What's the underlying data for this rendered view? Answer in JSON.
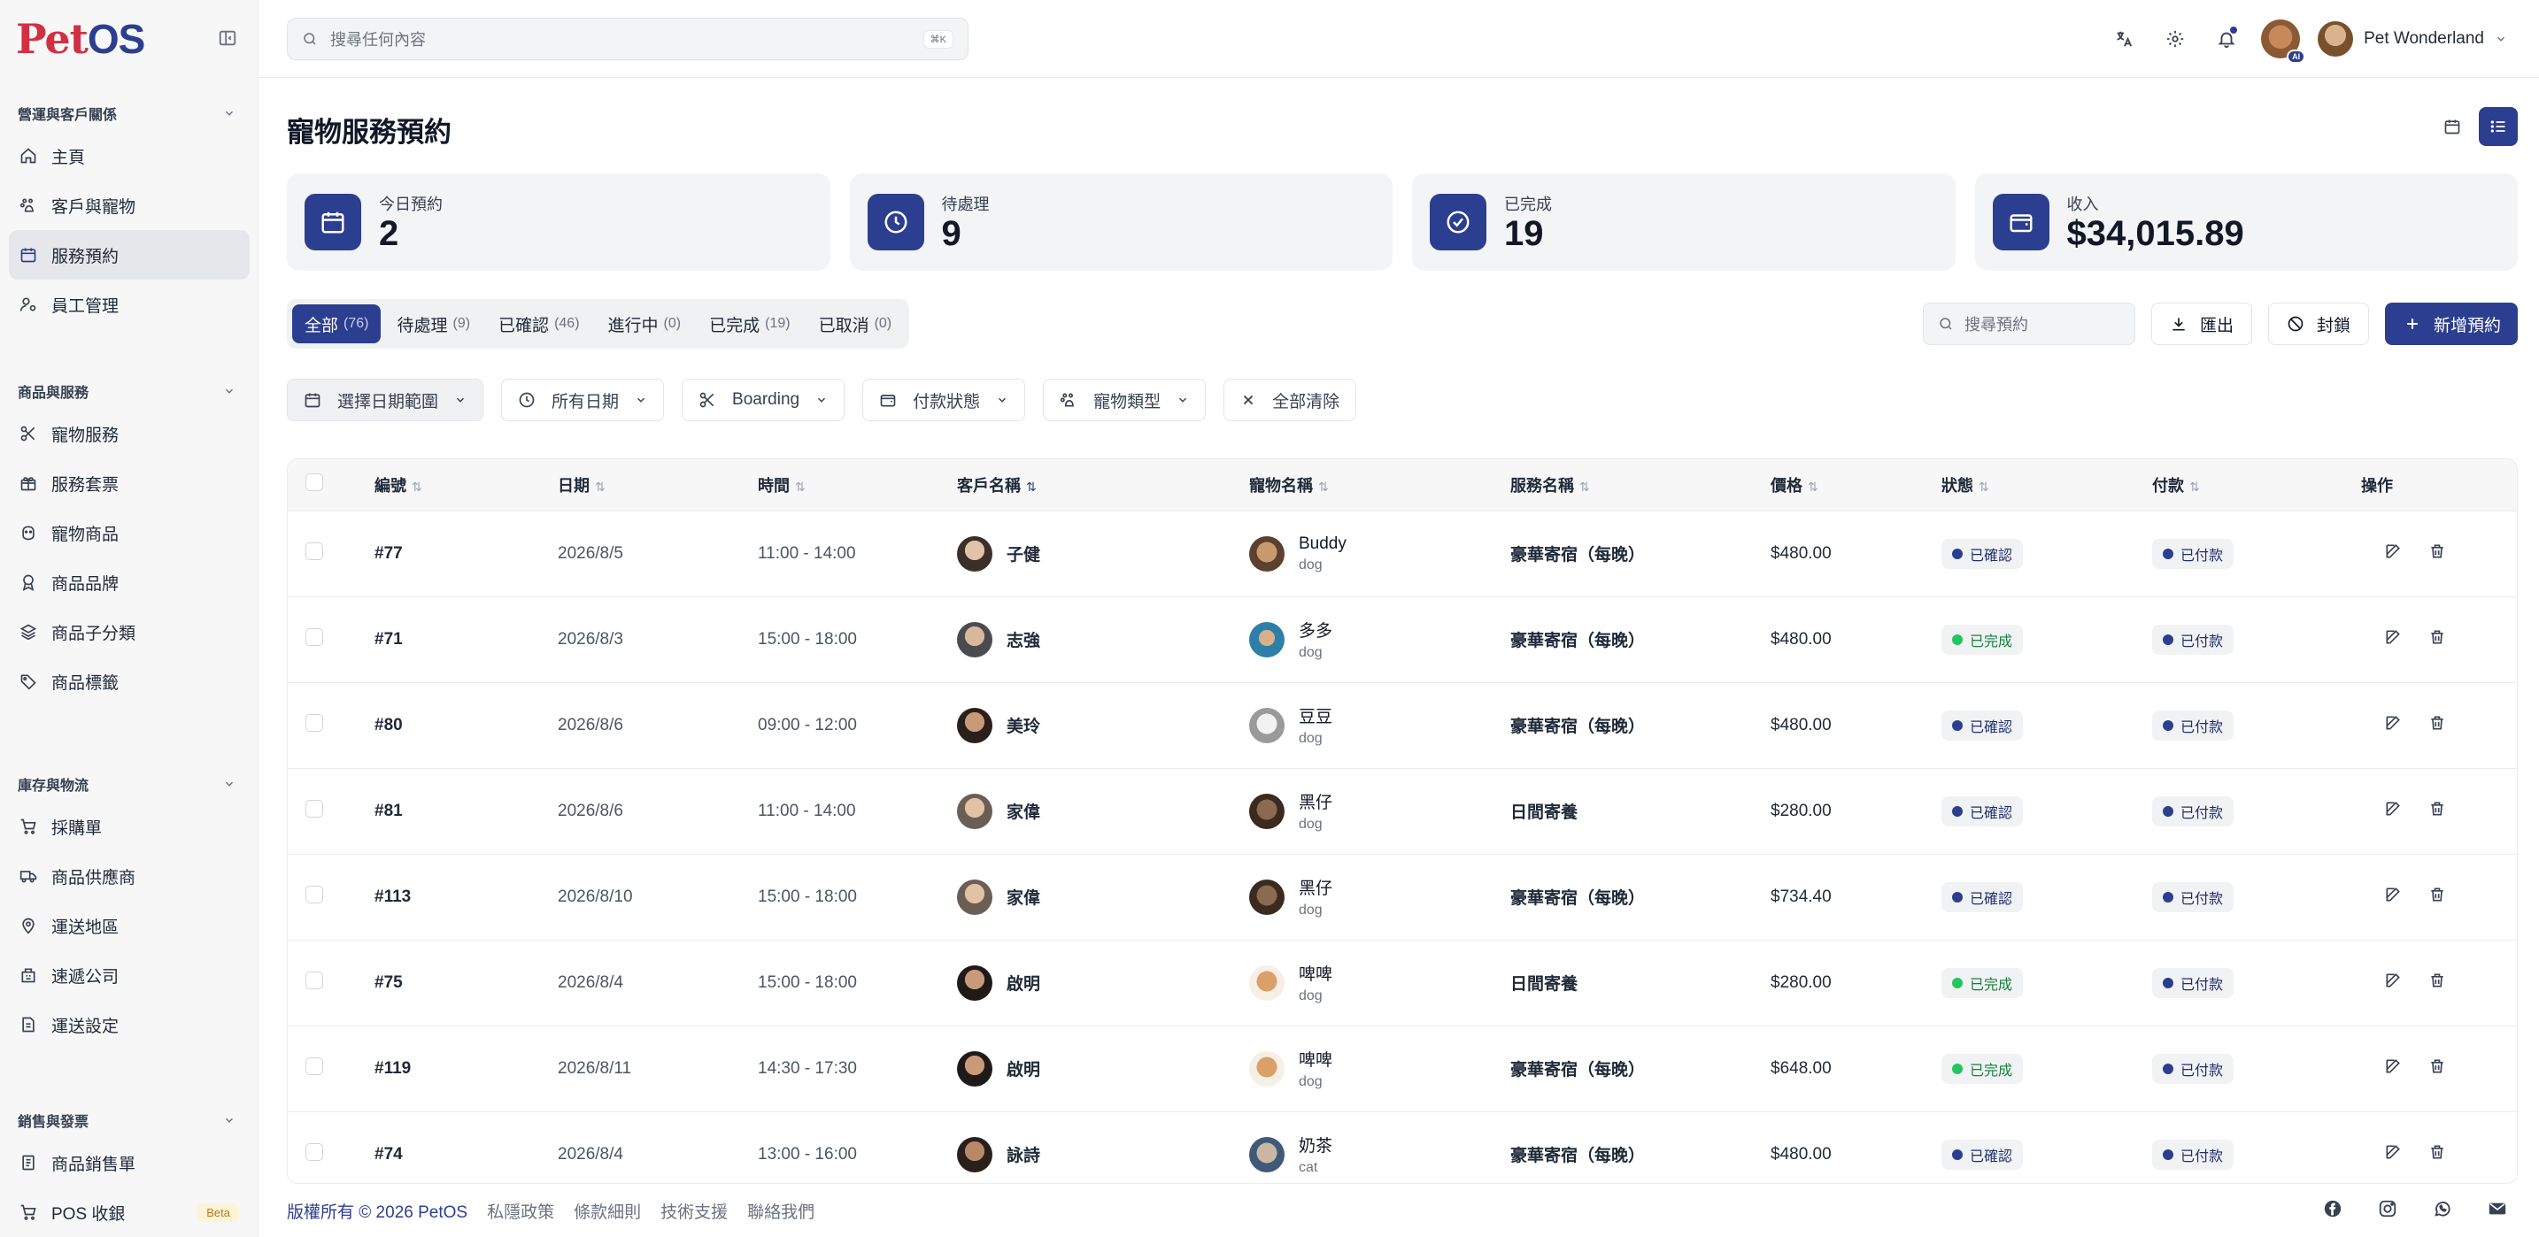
{
  "brand": {
    "pet": "Pet",
    "os": "OS"
  },
  "sidebar": {
    "groups": [
      {
        "title": "營運與客戶關係",
        "items": [
          {
            "label": "主頁",
            "icon": "home-icon"
          },
          {
            "label": "客戶與寵物",
            "icon": "paw-users-icon"
          },
          {
            "label": "服務預約",
            "icon": "calendar-icon",
            "active": true
          },
          {
            "label": "員工管理",
            "icon": "user-cog-icon"
          }
        ]
      },
      {
        "title": "商品與服務",
        "items": [
          {
            "label": "寵物服務",
            "icon": "scissors-icon"
          },
          {
            "label": "服務套票",
            "icon": "gift-icon"
          },
          {
            "label": "寵物商品",
            "icon": "dog-icon"
          },
          {
            "label": "商品品牌",
            "icon": "award-icon"
          },
          {
            "label": "商品子分類",
            "icon": "layers-icon"
          },
          {
            "label": "商品標籤",
            "icon": "tags-icon"
          }
        ]
      },
      {
        "title": "庫存與物流",
        "items": [
          {
            "label": "採購單",
            "icon": "cart-icon"
          },
          {
            "label": "商品供應商",
            "icon": "truck-icon"
          },
          {
            "label": "運送地區",
            "icon": "map-pin-icon"
          },
          {
            "label": "速遞公司",
            "icon": "building-icon"
          },
          {
            "label": "運送設定",
            "icon": "file-settings-icon"
          }
        ]
      },
      {
        "title": "銷售與發票",
        "items": [
          {
            "label": "商品銷售單",
            "icon": "receipt-icon"
          },
          {
            "label": "POS 收銀",
            "icon": "pos-cart-icon",
            "badge": "Beta"
          }
        ]
      }
    ]
  },
  "topbar": {
    "search_placeholder": "搜尋任何內容",
    "shortcut": "⌘K",
    "ai_badge": "AI",
    "user_name": "Pet Wonderland"
  },
  "page": {
    "title": "寵物服務預約",
    "stats": [
      {
        "label": "今日預約",
        "value": "2",
        "icon": "calendar-icon"
      },
      {
        "label": "待處理",
        "value": "9",
        "icon": "clock-icon"
      },
      {
        "label": "已完成",
        "value": "19",
        "icon": "check-circle-icon"
      },
      {
        "label": "收入",
        "value": "$34,015.89",
        "icon": "wallet-icon"
      }
    ],
    "tabs": [
      {
        "label": "全部",
        "count": "(76)",
        "active": true
      },
      {
        "label": "待處理",
        "count": "(9)"
      },
      {
        "label": "已確認",
        "count": "(46)"
      },
      {
        "label": "進行中",
        "count": "(0)"
      },
      {
        "label": "已完成",
        "count": "(19)"
      },
      {
        "label": "已取消",
        "count": "(0)"
      }
    ],
    "search_placeholder": "搜尋預約",
    "export_label": "匯出",
    "block_label": "封鎖",
    "new_label": "新增預約",
    "filters": {
      "date_range": "選擇日期範圍",
      "all_dates": "所有日期",
      "service": "Boarding",
      "payment_status": "付款狀態",
      "pet_type": "寵物類型",
      "clear": "全部清除"
    }
  },
  "table": {
    "headers": [
      "編號",
      "日期",
      "時間",
      "客戶名稱",
      "寵物名稱",
      "服務名稱",
      "價格",
      "狀態",
      "付款",
      "操作"
    ],
    "rows": [
      {
        "id": "#77",
        "date": "2026/8/5",
        "time": "11:00 - 14:00",
        "customer": "子健",
        "pet": "Buddy",
        "pet_type": "dog",
        "service": "豪華寄宿（每晚）",
        "price": "$480.00",
        "status": "已確認",
        "payment": "已付款"
      },
      {
        "id": "#71",
        "date": "2026/8/3",
        "time": "15:00 - 18:00",
        "customer": "志強",
        "pet": "多多",
        "pet_type": "dog",
        "service": "豪華寄宿（每晚）",
        "price": "$480.00",
        "status": "已完成",
        "payment": "已付款"
      },
      {
        "id": "#80",
        "date": "2026/8/6",
        "time": "09:00 - 12:00",
        "customer": "美玲",
        "pet": "豆豆",
        "pet_type": "dog",
        "service": "豪華寄宿（每晚）",
        "price": "$480.00",
        "status": "已確認",
        "payment": "已付款"
      },
      {
        "id": "#81",
        "date": "2026/8/6",
        "time": "11:00 - 14:00",
        "customer": "家偉",
        "pet": "黑仔",
        "pet_type": "dog",
        "service": "日間寄養",
        "price": "$280.00",
        "status": "已確認",
        "payment": "已付款"
      },
      {
        "id": "#113",
        "date": "2026/8/10",
        "time": "15:00 - 18:00",
        "customer": "家偉",
        "pet": "黑仔",
        "pet_type": "dog",
        "service": "豪華寄宿（每晚）",
        "price": "$734.40",
        "status": "已確認",
        "payment": "已付款"
      },
      {
        "id": "#75",
        "date": "2026/8/4",
        "time": "15:00 - 18:00",
        "customer": "啟明",
        "pet": "啤啤",
        "pet_type": "dog",
        "service": "日間寄養",
        "price": "$280.00",
        "status": "已完成",
        "payment": "已付款"
      },
      {
        "id": "#119",
        "date": "2026/8/11",
        "time": "14:30 - 17:30",
        "customer": "啟明",
        "pet": "啤啤",
        "pet_type": "dog",
        "service": "豪華寄宿（每晚）",
        "price": "$648.00",
        "status": "已完成",
        "payment": "已付款"
      },
      {
        "id": "#74",
        "date": "2026/8/4",
        "time": "13:00 - 16:00",
        "customer": "詠詩",
        "pet": "奶茶",
        "pet_type": "cat",
        "service": "豪華寄宿（每晚）",
        "price": "$480.00",
        "status": "已確認",
        "payment": "已付款"
      }
    ]
  },
  "footer": {
    "copyright": "版權所有 © 2026 PetOS",
    "links": [
      "私隱政策",
      "條款細則",
      "技術支援",
      "聯絡我們"
    ],
    "social": [
      "facebook-icon",
      "instagram-icon",
      "whatsapp-icon",
      "email-icon"
    ]
  },
  "colors": {
    "primary": "#2c3e8f",
    "brand_red": "#d32f43",
    "success": "#22c55e"
  }
}
